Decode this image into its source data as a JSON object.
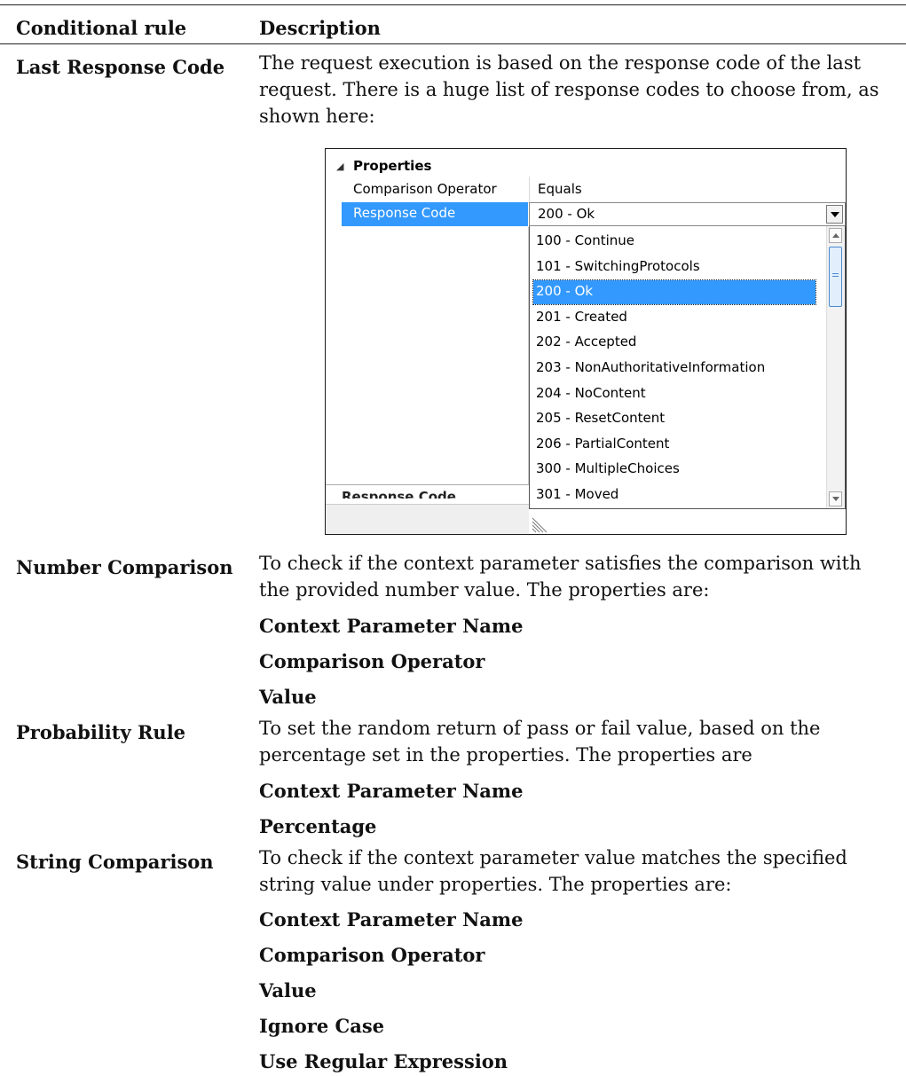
{
  "table": {
    "header": {
      "col1": "Conditional rule",
      "col2": "Description"
    },
    "rows": [
      {
        "name": "Last Response Code",
        "description": "The request execution is based on the response code of the last request. There is a huge list of response codes to choose from, as shown here:",
        "properties": []
      },
      {
        "name": "Number Comparison",
        "description": "To check if the context parameter satisfies the comparison with the provided number value. The properties are:",
        "properties": [
          "Context Parameter Name",
          "Comparison Operator",
          "Value"
        ]
      },
      {
        "name": "Probability Rule",
        "description": "To set the random return of pass or fail value, based on the percentage set in the properties. The properties are",
        "properties": [
          "Context Parameter Name",
          "Percentage"
        ]
      },
      {
        "name": "String Comparison",
        "description": "To check if the context parameter value matches the specified string value under properties. The properties are:",
        "properties": [
          "Context Parameter Name",
          "Comparison Operator",
          "Value",
          "Ignore Case",
          "Use Regular Expression"
        ]
      }
    ]
  },
  "window": {
    "section": "Properties",
    "row1": {
      "label": "Comparison Operator",
      "value": "Equals"
    },
    "row2": {
      "label": "Response Code",
      "value": "200 - Ok"
    },
    "dropdown": [
      "100 - Continue",
      "101 - SwitchingProtocols",
      "200 - Ok",
      "201 - Created",
      "202 - Accepted",
      "203 - NonAuthoritativeInformation",
      "204 - NoContent",
      "205 - ResetContent",
      "206 - PartialContent",
      "300 - MultipleChoices",
      "301 - Moved"
    ],
    "selected_index": 2,
    "description_title": "Response Code",
    "colors": {
      "selection": "#3399ff"
    }
  }
}
